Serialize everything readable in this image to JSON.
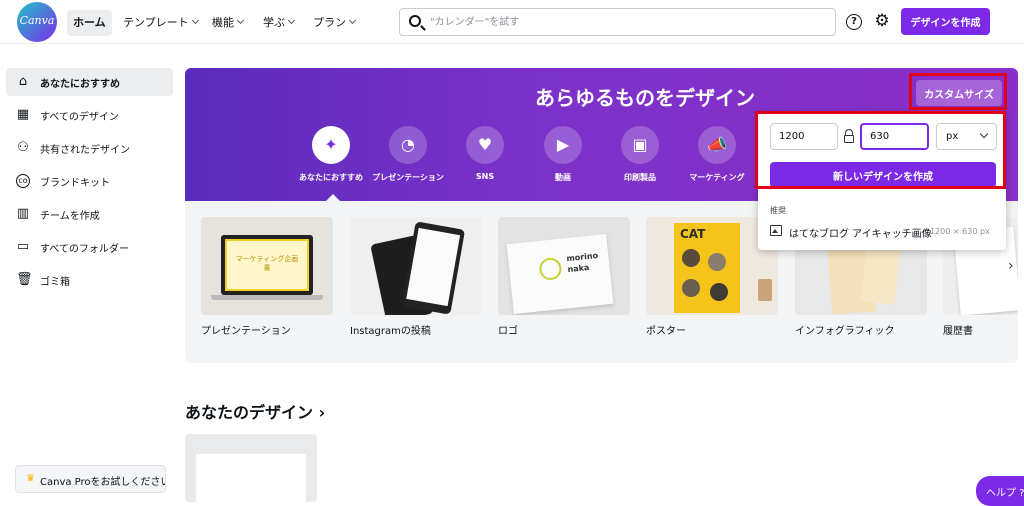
{
  "logo": {
    "text": "Canva"
  },
  "nav": {
    "home": "ホーム",
    "templates": "テンプレート",
    "features": "機能",
    "learn": "学ぶ",
    "plans": "プラン"
  },
  "search": {
    "placeholder": "\"カレンダー\"を試す",
    "value": ""
  },
  "header": {
    "help_icon": "?",
    "gear_icon": "⚙",
    "create_label": "デザインを作成"
  },
  "sidebar": {
    "items": [
      {
        "label": "あなたにおすすめ",
        "icon": "home-icon"
      },
      {
        "label": "すべてのデザイン",
        "icon": "grid-icon"
      },
      {
        "label": "共有されたデザイン",
        "icon": "people-icon"
      },
      {
        "label": "ブランドキット",
        "icon": "brand-icon"
      },
      {
        "label": "チームを作成",
        "icon": "team-icon"
      },
      {
        "label": "すべてのフォルダー",
        "icon": "folder-icon"
      },
      {
        "label": "ゴミ箱",
        "icon": "trash-icon"
      }
    ],
    "pro": "Canva Proをお試しください"
  },
  "hero": {
    "title": "あらゆるものをデザイン",
    "custom_size": "カスタムサイズ",
    "categories": [
      {
        "label": "あなたにおすすめ",
        "glyph": "✦"
      },
      {
        "label": "プレゼンテーション",
        "glyph": "◔"
      },
      {
        "label": "SNS",
        "glyph": "♥"
      },
      {
        "label": "動画",
        "glyph": "▶"
      },
      {
        "label": "印刷製品",
        "glyph": "▣"
      },
      {
        "label": "マーケティング",
        "glyph": "📣"
      }
    ]
  },
  "templates": [
    {
      "label": "プレゼンテーション"
    },
    {
      "label": "Instagramの投稿"
    },
    {
      "label": "ロゴ"
    },
    {
      "label": "ポスター"
    },
    {
      "label": "インフォグラフィック"
    },
    {
      "label": "履歴書"
    }
  ],
  "template_art": {
    "presentation_title": "マーケティング企画書",
    "logo_word1": "morino",
    "logo_word2": "naka",
    "poster_word": "CAT"
  },
  "your_designs": {
    "title": "あなたのデザイン ›"
  },
  "help": {
    "label": "ヘルプ ?"
  },
  "custom_dropdown": {
    "width": "1200",
    "height": "630",
    "unit": "px",
    "new_design": "新しいデザインを作成",
    "recommended_label": "推奨",
    "rec_name": "はてなブログ アイキャッチ画像",
    "rec_dims": "1200 × 630 px"
  },
  "colors": {
    "brand": "#7d2ae8",
    "highlight": "#e0001b",
    "hero_start": "#5b2bbb",
    "hero_end": "#8a30c8"
  }
}
